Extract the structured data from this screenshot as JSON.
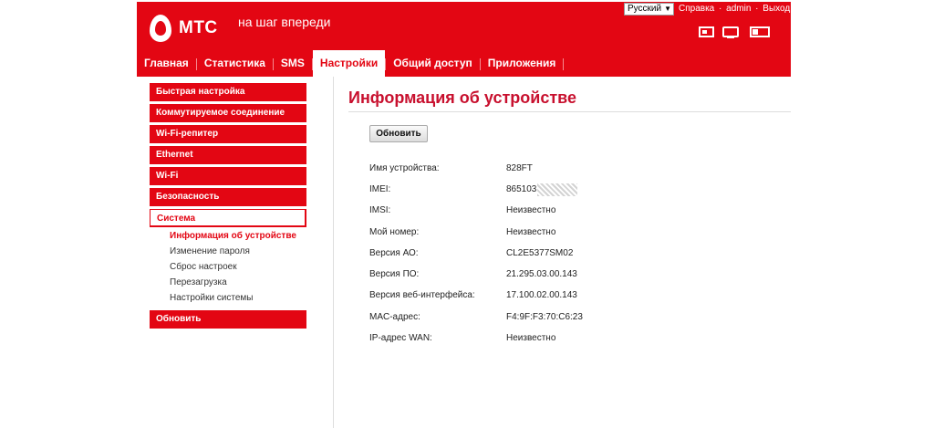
{
  "brand": {
    "name": "МТС",
    "slogan": "на шаг впереди",
    "color": "#e30613"
  },
  "topbar": {
    "language": "Русский",
    "links": [
      "Справка",
      "admin",
      "Выход"
    ],
    "separator": "·",
    "icons": [
      "sim-card-icon",
      "monitor-icon",
      "battery-icon"
    ]
  },
  "nav": {
    "items": [
      {
        "label": "Главная"
      },
      {
        "label": "Статистика"
      },
      {
        "label": "SMS"
      },
      {
        "label": "Настройки"
      },
      {
        "label": "Общий доступ"
      },
      {
        "label": "Приложения"
      }
    ],
    "active": "Настройки"
  },
  "sidebar": {
    "items": [
      {
        "label": "Быстрая настройка"
      },
      {
        "label": "Коммутируемое соединение"
      },
      {
        "label": "Wi-Fi-репитер"
      },
      {
        "label": "Ethernet"
      },
      {
        "label": "Wi-Fi"
      },
      {
        "label": "Безопасность"
      },
      {
        "label": "Система"
      },
      {
        "label": "Обновить"
      }
    ],
    "system_sub": [
      {
        "label": "Информация об устройстве"
      },
      {
        "label": "Изменение пароля"
      },
      {
        "label": "Сброс настроек"
      },
      {
        "label": "Перезагрузка"
      },
      {
        "label": "Настройки системы"
      }
    ]
  },
  "main": {
    "title": "Информация об устройстве",
    "refresh_label": "Обновить",
    "rows": [
      {
        "label": "Имя устройства:",
        "value": "828FT"
      },
      {
        "label": "IMEI:",
        "value": "865103"
      },
      {
        "label": "IMSI:",
        "value": "Неизвестно"
      },
      {
        "label": "Мой номер:",
        "value": "Неизвестно"
      },
      {
        "label": "Версия АО:",
        "value": "CL2E5377SM02"
      },
      {
        "label": "Версия ПО:",
        "value": "21.295.03.00.143"
      },
      {
        "label": "Версия веб-интерфейса:",
        "value": "17.100.02.00.143"
      },
      {
        "label": "MAC-адрес:",
        "value": "F4:9F:F3:70:C6:23"
      },
      {
        "label": "IP-адрес WAN:",
        "value": "Неизвестно"
      }
    ]
  }
}
